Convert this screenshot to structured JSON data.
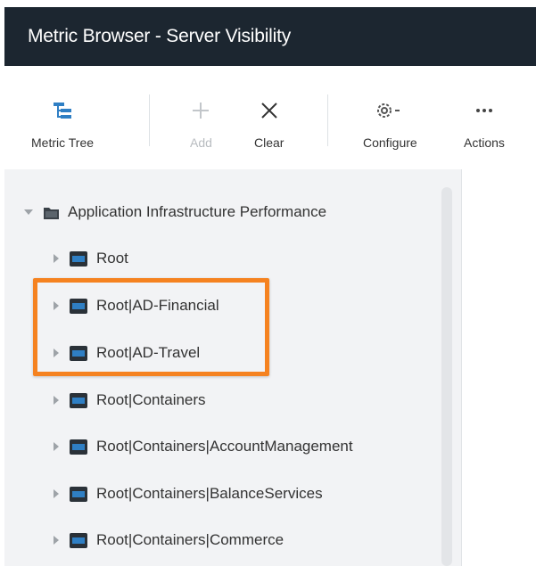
{
  "window": {
    "title": "Metric Browser - Server Visibility"
  },
  "toolbar": {
    "metric_tree": "Metric Tree",
    "add": "Add",
    "clear": "Clear",
    "configure": "Configure",
    "actions": "Actions"
  },
  "tree": {
    "root": {
      "label": "Application Infrastructure Performance",
      "expanded": true
    },
    "items": [
      {
        "label": "Root"
      },
      {
        "label": "Root|AD-Financial"
      },
      {
        "label": "Root|AD-Travel"
      },
      {
        "label": "Root|Containers"
      },
      {
        "label": "Root|Containers|AccountManagement"
      },
      {
        "label": "Root|Containers|BalanceServices"
      },
      {
        "label": "Root|Containers|Commerce"
      }
    ]
  },
  "colors": {
    "titlebar_bg": "#1c2630",
    "accent_blue": "#2f7fc4",
    "highlight_orange": "#f58220",
    "tree_bg": "#f2f3f5"
  }
}
